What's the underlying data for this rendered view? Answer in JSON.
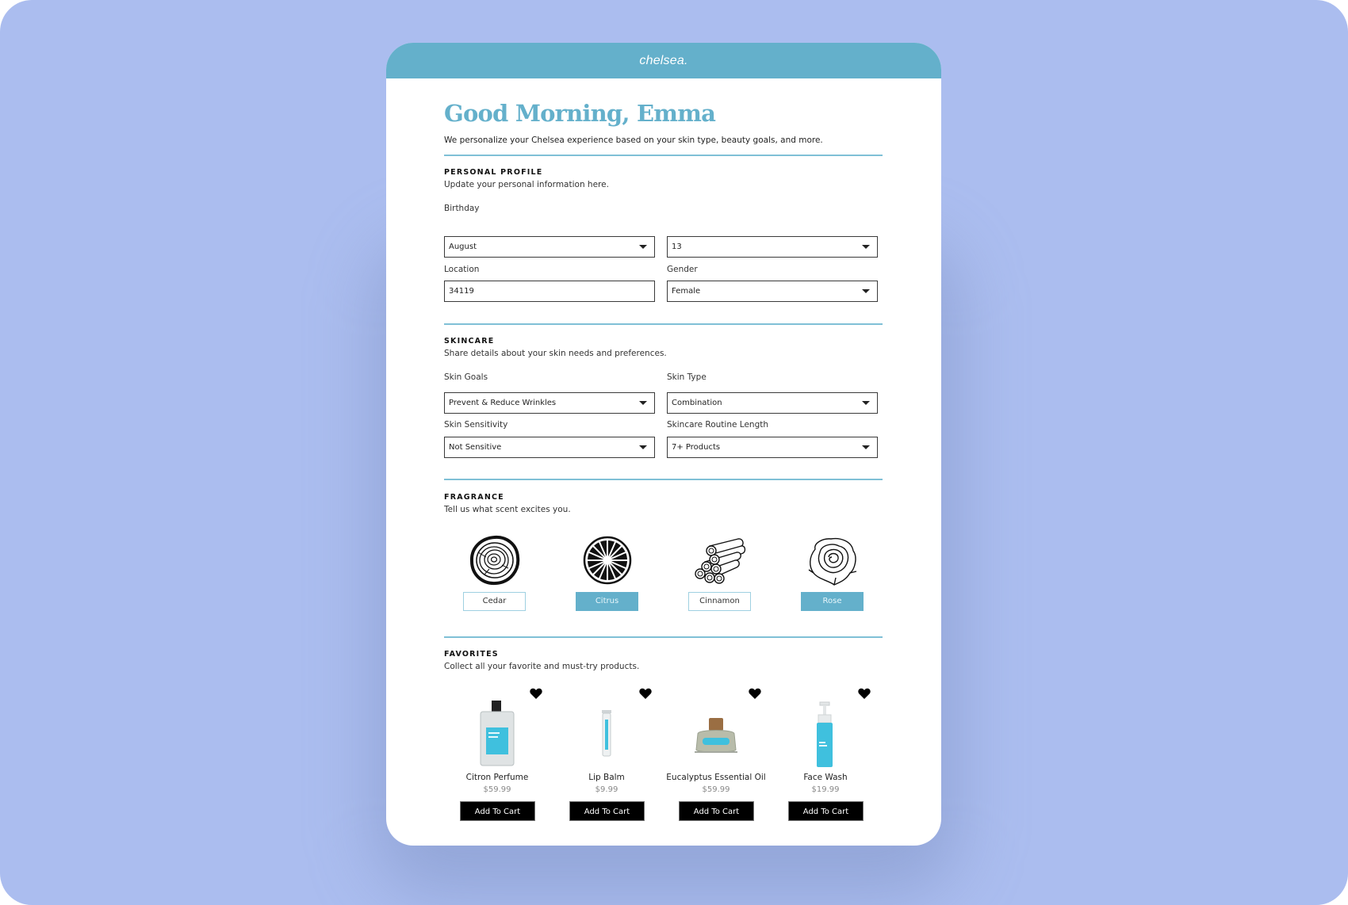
{
  "app": {
    "brand": "chelsea."
  },
  "colors": {
    "accent": "#64b0cb",
    "background": "#abbdef",
    "button": "#000000"
  },
  "header": {
    "title": "Good Morning, Emma",
    "subtitle": "We personalize your Chelsea experience based on your skin type, beauty goals, and more."
  },
  "profile": {
    "title": "PERSONAL PROFILE",
    "subtitle": "Update your personal information here.",
    "birthday_label": "Birthday",
    "birthday_month": "August",
    "birthday_day": "13",
    "location_label": "Location",
    "location_value": "34119",
    "gender_label": "Gender",
    "gender_value": "Female"
  },
  "skincare": {
    "title": "SKINCARE",
    "subtitle": "Share details about your skin needs and preferences.",
    "goals_label": "Skin Goals",
    "goals_value": "Prevent & Reduce Wrinkles",
    "type_label": "Skin Type",
    "type_value": "Combination",
    "sensitivity_label": "Skin Sensitivity",
    "sensitivity_value": "Not Sensitive",
    "routine_label": "Skincare Routine Length",
    "routine_value": "7+ Products"
  },
  "fragrance": {
    "title": "FRAGRANCE",
    "subtitle": "Tell us what scent excites you.",
    "options": [
      {
        "label": "Cedar",
        "icon": "tree-rings-icon",
        "selected": false
      },
      {
        "label": "Citrus",
        "icon": "citrus-slice-icon",
        "selected": true
      },
      {
        "label": "Cinnamon",
        "icon": "cinnamon-sticks-icon",
        "selected": false
      },
      {
        "label": "Rose",
        "icon": "rose-icon",
        "selected": true
      }
    ]
  },
  "favorites": {
    "title": "FAVORITES",
    "subtitle": "Collect all your favorite and must-try products.",
    "products": [
      {
        "name": "Citron Perfume",
        "price": "$59.99",
        "cta": "Add To Cart",
        "icon": "perfume-bottle-icon"
      },
      {
        "name": "Lip Balm",
        "price": "$9.99",
        "cta": "Add To Cart",
        "icon": "lip-balm-tube-icon"
      },
      {
        "name": "Eucalyptus Essential Oil",
        "price": "$59.99",
        "cta": "Add To Cart",
        "icon": "oil-bottle-icon"
      },
      {
        "name": "Face Wash",
        "price": "$19.99",
        "cta": "Add To Cart",
        "icon": "foam-pump-bottle-icon"
      }
    ]
  }
}
